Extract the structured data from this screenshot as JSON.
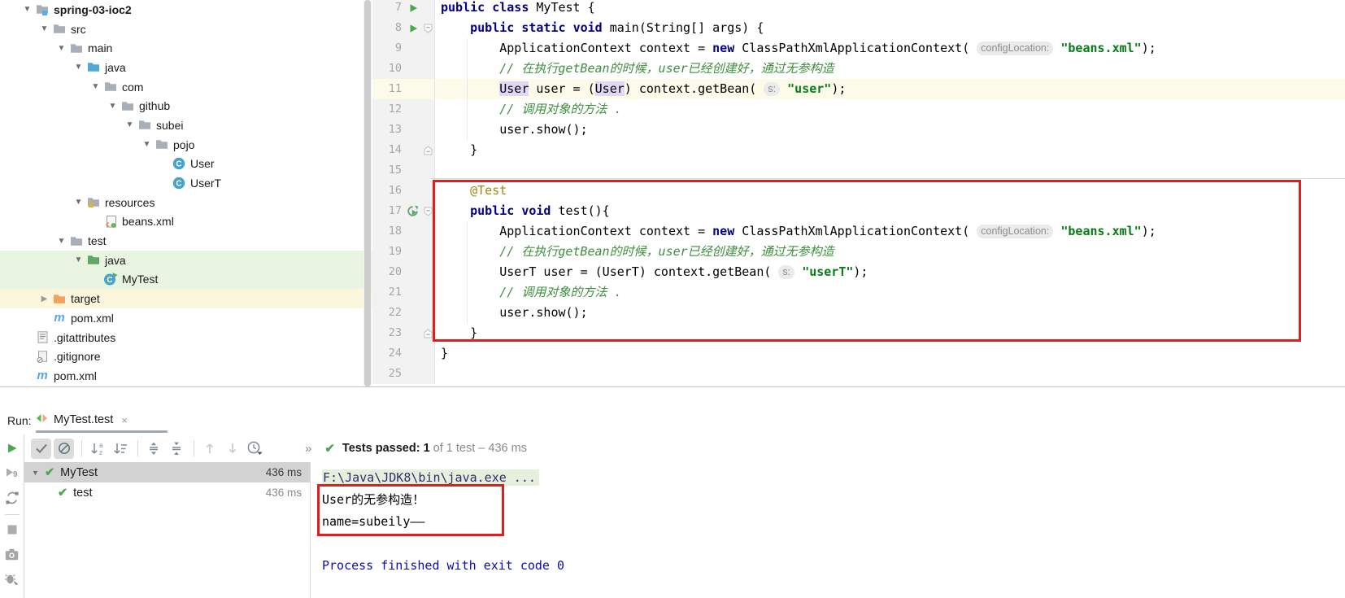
{
  "project_panel": {
    "items": [
      {
        "label": "spring-03-ioc2",
        "depth": 1,
        "arrow": "open",
        "icon": "folder-project",
        "bold": true,
        "bg": "none"
      },
      {
        "label": "src",
        "depth": 2,
        "arrow": "open",
        "icon": "folder",
        "bold": false,
        "bg": "none"
      },
      {
        "label": "main",
        "depth": 3,
        "arrow": "open",
        "icon": "folder",
        "bold": false,
        "bg": "none"
      },
      {
        "label": "java",
        "depth": 4,
        "arrow": "open",
        "icon": "folder-sources",
        "bold": false,
        "bg": "none"
      },
      {
        "label": "com",
        "depth": 5,
        "arrow": "open",
        "icon": "folder-package",
        "bold": false,
        "bg": "none"
      },
      {
        "label": "github",
        "depth": 6,
        "arrow": "open",
        "icon": "folder-package",
        "bold": false,
        "bg": "none"
      },
      {
        "label": "subei",
        "depth": 7,
        "arrow": "open",
        "icon": "folder-package",
        "bold": false,
        "bg": "none"
      },
      {
        "label": "pojo",
        "depth": 8,
        "arrow": "open",
        "icon": "folder-package",
        "bold": false,
        "bg": "none"
      },
      {
        "label": "User",
        "depth": 9,
        "arrow": "none",
        "icon": "class",
        "bold": false,
        "bg": "none"
      },
      {
        "label": "UserT",
        "depth": 9,
        "arrow": "none",
        "icon": "class",
        "bold": false,
        "bg": "none"
      },
      {
        "label": "resources",
        "depth": 4,
        "arrow": "open",
        "icon": "folder-resources",
        "bold": false,
        "bg": "none"
      },
      {
        "label": "beans.xml",
        "depth": 5,
        "arrow": "none",
        "icon": "spring-config",
        "bold": false,
        "bg": "none"
      },
      {
        "label": "test",
        "depth": 3,
        "arrow": "open",
        "icon": "folder",
        "bold": false,
        "bg": "none"
      },
      {
        "label": "java",
        "depth": 4,
        "arrow": "open",
        "icon": "folder-test",
        "bold": false,
        "bg": "green"
      },
      {
        "label": "MyTest",
        "depth": 5,
        "arrow": "none",
        "icon": "class-runnable",
        "bold": false,
        "bg": "green"
      },
      {
        "label": "target",
        "depth": 2,
        "arrow": "collapsed",
        "icon": "folder-excluded",
        "bold": false,
        "bg": "cream"
      },
      {
        "label": "pom.xml",
        "depth": 2,
        "arrow": "none",
        "icon": "maven",
        "bold": false,
        "bg": "none"
      },
      {
        "label": ".gitattributes",
        "depth": 1,
        "arrow": "none",
        "icon": "git-attributes",
        "bold": false,
        "bg": "none"
      },
      {
        "label": ".gitignore",
        "depth": 1,
        "arrow": "none",
        "icon": "git-ignore",
        "bold": false,
        "bg": "none"
      },
      {
        "label": "pom.xml",
        "depth": 1,
        "arrow": "none",
        "icon": "maven",
        "bold": false,
        "bg": "none"
      }
    ]
  },
  "editor": {
    "lines": [
      {
        "num": 7,
        "gutter": "run",
        "fold": "none",
        "hl": false,
        "tokens": [
          [
            "k",
            "public"
          ],
          [
            "p",
            " "
          ],
          [
            "k",
            "class"
          ],
          [
            "p",
            " MyTest {"
          ]
        ]
      },
      {
        "num": 8,
        "gutter": "run",
        "fold": "down",
        "hl": false,
        "tokens": [
          [
            "p",
            "    "
          ],
          [
            "k",
            "public"
          ],
          [
            "p",
            " "
          ],
          [
            "k",
            "static"
          ],
          [
            "p",
            " "
          ],
          [
            "k",
            "void"
          ],
          [
            "p",
            " main(String[] args) {"
          ]
        ]
      },
      {
        "num": 9,
        "gutter": "none",
        "fold": "none",
        "hl": false,
        "tokens": [
          [
            "p",
            "        ApplicationContext context = "
          ],
          [
            "k",
            "new"
          ],
          [
            "p",
            " ClassPathXmlApplicationContext( "
          ],
          [
            "h",
            "configLocation:"
          ],
          [
            "p",
            " "
          ],
          [
            "s",
            "\"beans.xml\""
          ],
          [
            "p",
            ");"
          ]
        ]
      },
      {
        "num": 10,
        "gutter": "none",
        "fold": "none",
        "hl": false,
        "tokens": [
          [
            "p",
            "        "
          ],
          [
            "c",
            "// 在执行getBean的时候，user已经创建好，通过无参构造"
          ]
        ]
      },
      {
        "num": 11,
        "gutter": "none",
        "fold": "none",
        "hl": true,
        "tokens": [
          [
            "p",
            "        "
          ],
          [
            "i",
            "User"
          ],
          [
            "p",
            " user = ("
          ],
          [
            "i",
            "User"
          ],
          [
            "p",
            ") context.getBean( "
          ],
          [
            "h",
            "s:"
          ],
          [
            "p",
            " "
          ],
          [
            "s",
            "\"user\""
          ],
          [
            "p",
            ");"
          ]
        ]
      },
      {
        "num": 12,
        "gutter": "none",
        "fold": "none",
        "hl": false,
        "tokens": [
          [
            "p",
            "        "
          ],
          [
            "c",
            "// 调用对象的方法 ."
          ]
        ]
      },
      {
        "num": 13,
        "gutter": "none",
        "fold": "none",
        "hl": false,
        "tokens": [
          [
            "p",
            "        user.show();"
          ]
        ]
      },
      {
        "num": 14,
        "gutter": "none",
        "fold": "up",
        "hl": false,
        "tokens": [
          [
            "p",
            "    }"
          ]
        ]
      },
      {
        "num": 15,
        "gutter": "none",
        "fold": "none",
        "hl": false,
        "tokens": []
      },
      {
        "num": 16,
        "gutter": "none",
        "fold": "none",
        "hl": false,
        "tokens": [
          [
            "p",
            "    "
          ],
          [
            "a",
            "@Test"
          ]
        ]
      },
      {
        "num": 17,
        "gutter": "test",
        "fold": "down",
        "hl": false,
        "tokens": [
          [
            "p",
            "    "
          ],
          [
            "k",
            "public"
          ],
          [
            "p",
            " "
          ],
          [
            "k",
            "void"
          ],
          [
            "p",
            " test(){"
          ]
        ]
      },
      {
        "num": 18,
        "gutter": "none",
        "fold": "none",
        "hl": false,
        "tokens": [
          [
            "p",
            "        ApplicationContext context = "
          ],
          [
            "k",
            "new"
          ],
          [
            "p",
            " ClassPathXmlApplicationContext( "
          ],
          [
            "h",
            "configLocation:"
          ],
          [
            "p",
            " "
          ],
          [
            "s",
            "\"beans.xml\""
          ],
          [
            "p",
            ");"
          ]
        ]
      },
      {
        "num": 19,
        "gutter": "none",
        "fold": "none",
        "hl": false,
        "tokens": [
          [
            "p",
            "        "
          ],
          [
            "c",
            "// 在执行getBean的时候，user已经创建好，通过无参构造"
          ]
        ]
      },
      {
        "num": 20,
        "gutter": "none",
        "fold": "none",
        "hl": false,
        "tokens": [
          [
            "p",
            "        UserT user = (UserT) context.getBean( "
          ],
          [
            "h",
            "s:"
          ],
          [
            "p",
            " "
          ],
          [
            "s",
            "\"userT\""
          ],
          [
            "p",
            ");"
          ]
        ]
      },
      {
        "num": 21,
        "gutter": "none",
        "fold": "none",
        "hl": false,
        "tokens": [
          [
            "p",
            "        "
          ],
          [
            "c",
            "// 调用对象的方法 ."
          ]
        ]
      },
      {
        "num": 22,
        "gutter": "none",
        "fold": "none",
        "hl": false,
        "tokens": [
          [
            "p",
            "        user.show();"
          ]
        ]
      },
      {
        "num": 23,
        "gutter": "none",
        "fold": "up",
        "hl": false,
        "tokens": [
          [
            "p",
            "    }"
          ]
        ]
      },
      {
        "num": 24,
        "gutter": "none",
        "fold": "none",
        "hl": false,
        "tokens": [
          [
            "p",
            "}"
          ]
        ]
      },
      {
        "num": 25,
        "gutter": "none",
        "fold": "none",
        "hl": false,
        "tokens": []
      }
    ]
  },
  "run_panel": {
    "label": "Run:",
    "tab": {
      "title": "MyTest.test",
      "close": "×"
    },
    "left_toolbar": [
      {
        "name": "rerun"
      },
      {
        "name": "rerun-failed-tests"
      },
      {
        "name": "toggle-auto-test"
      },
      {
        "divider": true
      },
      {
        "name": "stop"
      },
      {
        "name": "screenshot"
      },
      {
        "name": "attach-debugger"
      }
    ],
    "toolbar": [
      {
        "name": "show-passed",
        "pressed": true
      },
      {
        "name": "show-ignored",
        "pressed": true
      },
      {
        "sep": true
      },
      {
        "name": "sort-alphabetically"
      },
      {
        "name": "sort-by-duration"
      },
      {
        "sep": true
      },
      {
        "name": "expand-all"
      },
      {
        "name": "collapse-all"
      },
      {
        "sep": true
      },
      {
        "name": "previous-failed-test"
      },
      {
        "name": "next-failed-test"
      },
      {
        "name": "test-history"
      }
    ],
    "more_label": "»",
    "status": {
      "strong": "Tests passed: 1",
      "rest": " of 1 test – 436 ms"
    },
    "tests": [
      {
        "name": "MyTest",
        "time": "436 ms",
        "selected": true,
        "arrow": true
      },
      {
        "name": "test",
        "time": "436 ms",
        "selected": false,
        "arrow": false
      }
    ],
    "console": {
      "lines": [
        {
          "text": "F:\\Java\\JDK8\\bin\\java.exe ...",
          "style": "cmd"
        },
        {
          "text": "User的无参构造！",
          "style": "out"
        },
        {
          "text": "name=subeily——",
          "style": "out"
        },
        {
          "text": "",
          "style": "out"
        },
        {
          "text": "Process finished with exit code 0",
          "style": "sys"
        }
      ]
    }
  }
}
